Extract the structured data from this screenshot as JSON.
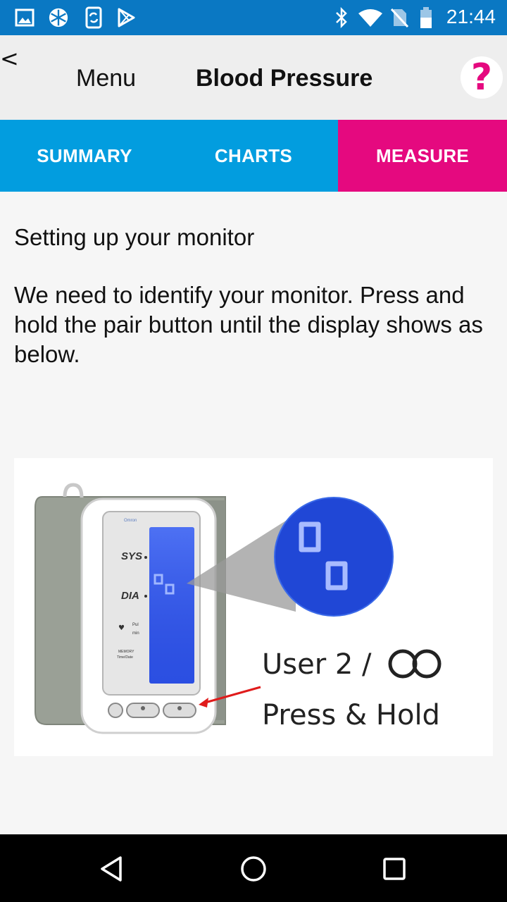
{
  "status_bar": {
    "time": "21:44",
    "icons": [
      "image-icon",
      "snowflake-icon",
      "sync-phone-icon",
      "play-store-icon",
      "bluetooth-icon",
      "wifi-icon",
      "no-sim-icon",
      "battery-icon"
    ]
  },
  "header": {
    "back_label": "<",
    "menu_label": "Menu",
    "title": "Blood Pressure",
    "help_label": "?"
  },
  "tabs": [
    {
      "label": "SUMMARY",
      "active": false
    },
    {
      "label": "CHARTS",
      "active": false
    },
    {
      "label": "MEASURE",
      "active": true
    }
  ],
  "content": {
    "heading": "Setting up your monitor",
    "instruction": "We need to identify your monitor.  Press and hold the pair button until the display shows as below."
  },
  "illustration": {
    "screen_labels": {
      "sys": "SYS",
      "dia": "DIA",
      "pul": "Pul",
      "min": "min",
      "memory": "MEMORY",
      "time_date": "Time/Date"
    },
    "user_text": "User 2 /",
    "press_text": "Press & Hold"
  },
  "colors": {
    "status_bar": "#0a78c3",
    "tab_bar": "#029ddf",
    "active_tab": "#e5097f",
    "help_icon": "#e5097f"
  }
}
